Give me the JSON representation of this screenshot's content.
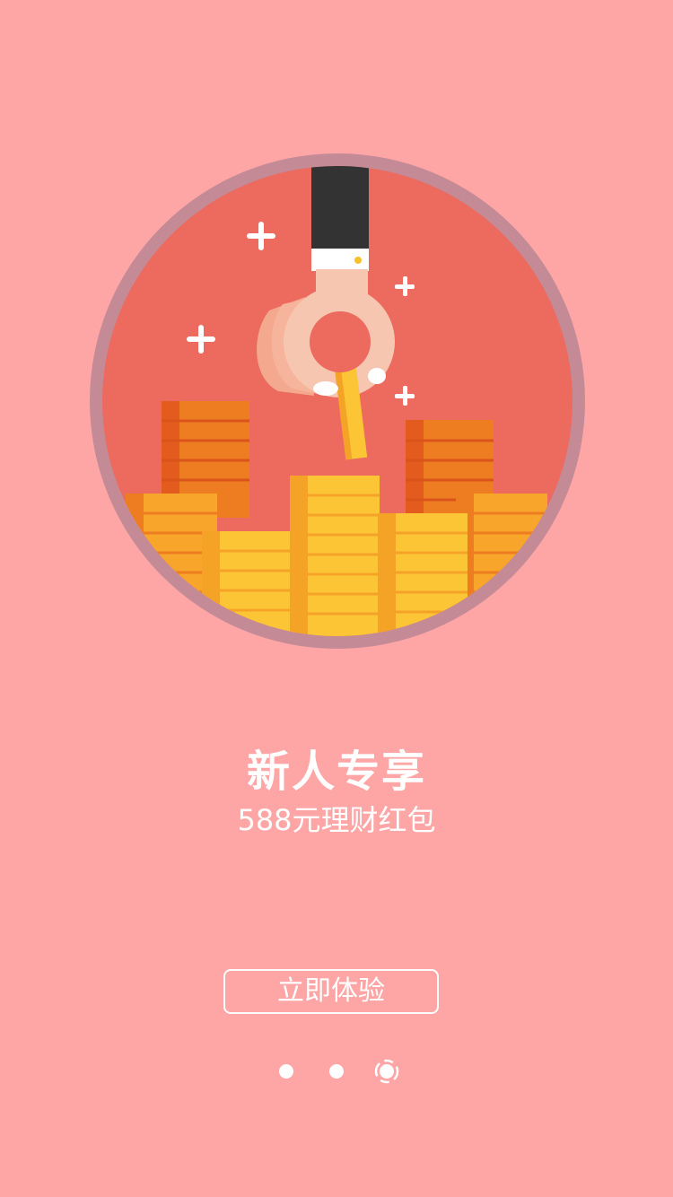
{
  "colors": {
    "background": "#FEA5A5",
    "circle_fill": "#EC6A5E",
    "circle_ring": "#C48B97",
    "coin_gold": "#FBC535",
    "coin_orange": "#EE7C21",
    "sleeve": "#333333",
    "hand": "#F6C6B1"
  },
  "illustration": {
    "name": "hand-with-coin-stacks-illustration"
  },
  "promo": {
    "title": "新人专享",
    "subtitle": "588元理财红包"
  },
  "cta": {
    "label": "立即体验"
  },
  "pager": {
    "total": 3,
    "active_index": 3
  }
}
